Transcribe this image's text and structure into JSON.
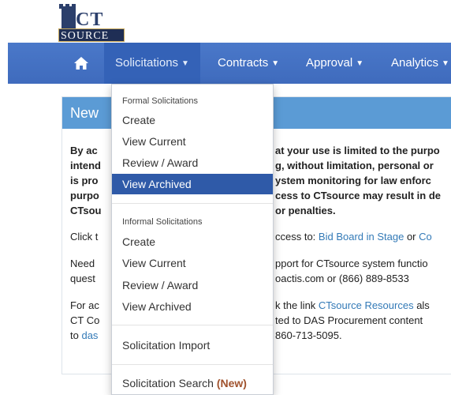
{
  "logo": {
    "top_text": "CT",
    "bottom_text": "SOURCE"
  },
  "nav": {
    "home_icon": "home-icon",
    "items": [
      {
        "label": "Solicitations",
        "active": true
      },
      {
        "label": "Contracts"
      },
      {
        "label": "Approval"
      },
      {
        "label": "Analytics"
      }
    ]
  },
  "panel": {
    "title": "New",
    "lines": [
      {
        "left": "By ac",
        "right": "at your use is limited to the purpo"
      },
      {
        "left": "intend",
        "right": "g, without limitation, personal or"
      },
      {
        "left": "is pro",
        "right": "ystem monitoring for law enforc"
      },
      {
        "left": "purpo",
        "right": "cess to CTsource may result in de"
      },
      {
        "left": "CTsou",
        "right": "or penalties."
      },
      {
        "left": "Click t",
        "right_prefix": "ccess to: ",
        "link1": "Bid Board in Stage",
        "mid": " or ",
        "link2": "Co"
      },
      {
        "left": "Need",
        "right": "pport for CTsource system functio"
      },
      {
        "left": "quest",
        "right": "oactis.com or (866) 889-8533"
      },
      {
        "left": "For ac",
        "right_prefix": "k the link ",
        "link1": "CTsource Resources",
        "mid": " als"
      },
      {
        "left": "CT Co",
        "right": "ted to DAS Procurement content"
      },
      {
        "left": "to ",
        "left_link": "das",
        "right": "860-713-5095."
      }
    ]
  },
  "dropdown": {
    "formal_header": "Formal Solicitations",
    "formal_items": [
      "Create",
      "View Current",
      "Review / Award",
      "View Archived"
    ],
    "informal_header": "Informal Solicitations",
    "informal_items": [
      "Create",
      "View Current",
      "Review / Award",
      "View Archived"
    ],
    "import_label": "Solicitation Import",
    "search_label": "Solicitation Search",
    "search_badge": "(New)"
  },
  "colors": {
    "navbar": "#4472c4",
    "active_nav": "#3462b7",
    "selected_item": "#2f5aa8",
    "panel_header": "#5b9bd5",
    "link": "#337ab7",
    "new_badge": "#a0522d"
  }
}
